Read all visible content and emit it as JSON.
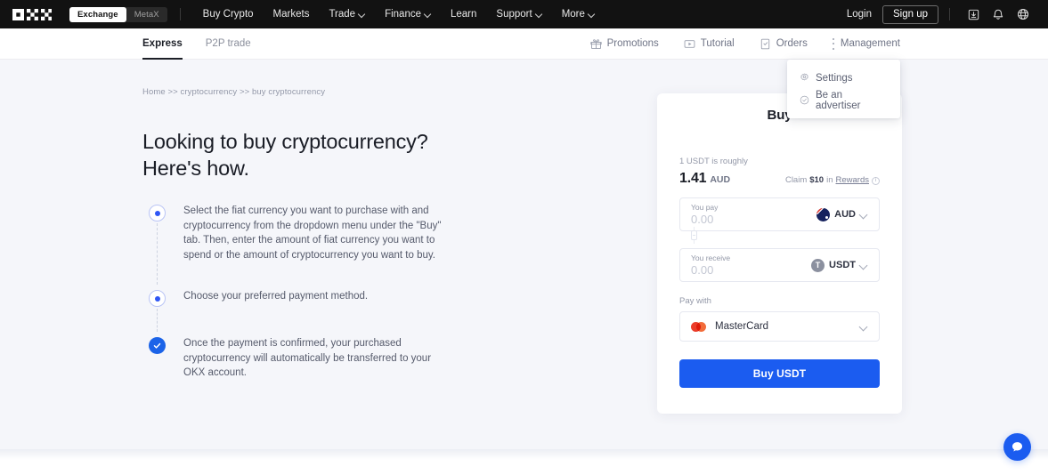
{
  "topnav": {
    "logo_alt": "OKX",
    "segments": [
      {
        "label": "Exchange",
        "active": true
      },
      {
        "label": "MetaX",
        "active": false
      }
    ],
    "links": [
      {
        "label": "Buy Crypto",
        "caret": false
      },
      {
        "label": "Markets",
        "caret": false
      },
      {
        "label": "Trade",
        "caret": true
      },
      {
        "label": "Finance",
        "caret": true
      },
      {
        "label": "Learn",
        "caret": false
      },
      {
        "label": "Support",
        "caret": true
      },
      {
        "label": "More",
        "caret": true
      }
    ],
    "login_label": "Login",
    "signup_label": "Sign up",
    "icons": [
      "download-icon",
      "bell-icon",
      "globe-icon"
    ]
  },
  "subnav": {
    "tabs": [
      {
        "label": "Express",
        "active": true
      },
      {
        "label": "P2P trade",
        "active": false
      }
    ],
    "items": [
      {
        "label": "Promotions",
        "icon": "gift-icon"
      },
      {
        "label": "Tutorial",
        "icon": "play-icon"
      },
      {
        "label": "Orders",
        "icon": "document-icon"
      },
      {
        "label": "Management",
        "icon": "kebab-icon"
      }
    ]
  },
  "dropdown": {
    "items": [
      {
        "label": "Settings",
        "icon": "gear-icon"
      },
      {
        "label": "Be an advertiser",
        "icon": "check-circle-icon"
      }
    ]
  },
  "main": {
    "breadcrumb": "Home >> cryptocurrency >> buy cryptocurrency",
    "heading_line1": "Looking to buy cryptocurrency?",
    "heading_line2": "Here's how.",
    "steps": [
      {
        "text": "Select the fiat currency you want to purchase with and cryptocurrency from the dropdown menu under the \"Buy\" tab. Then, enter the amount of fiat currency you want to spend or the amount of cryptocurrency you want to buy.",
        "state": "pending"
      },
      {
        "text": "Choose your preferred payment method.",
        "state": "pending"
      },
      {
        "text": "Once the payment is confirmed, your purchased cryptocurrency will automatically be transferred to your OKX account.",
        "state": "done"
      }
    ]
  },
  "buy_card": {
    "title": "Buy",
    "rate_label": "1 USDT is roughly",
    "rate_value": "1.41",
    "rate_unit": "AUD",
    "claim_prefix": "Claim",
    "claim_amount": "$10",
    "claim_middle": "in",
    "claim_link": "Rewards",
    "pay_field": {
      "caption": "You pay",
      "value": "0.00",
      "placeholder": "0.00",
      "currency": "AUD",
      "currency_icon": "flag-aud-icon"
    },
    "receive_field": {
      "caption": "You receive",
      "value": "0.00",
      "placeholder": "0.00",
      "currency": "USDT",
      "currency_icon": "usdt-icon"
    },
    "pay_with_label": "Pay with",
    "payment_method": "MasterCard",
    "payment_icon": "mastercard-icon",
    "submit_label": "Buy USDT"
  },
  "chat": {
    "icon": "chat-bubble-icon"
  },
  "colors": {
    "nav_bg": "#121212",
    "canvas_bg": "#f5f6fa",
    "accent_blue": "#1b5cf0",
    "step_blue": "#2f56f5",
    "text_dark": "#1a1d26",
    "text_muted": "#9398a8",
    "mastercard_red": "#eb3d2a",
    "mastercard_orange": "#f26c3a"
  }
}
